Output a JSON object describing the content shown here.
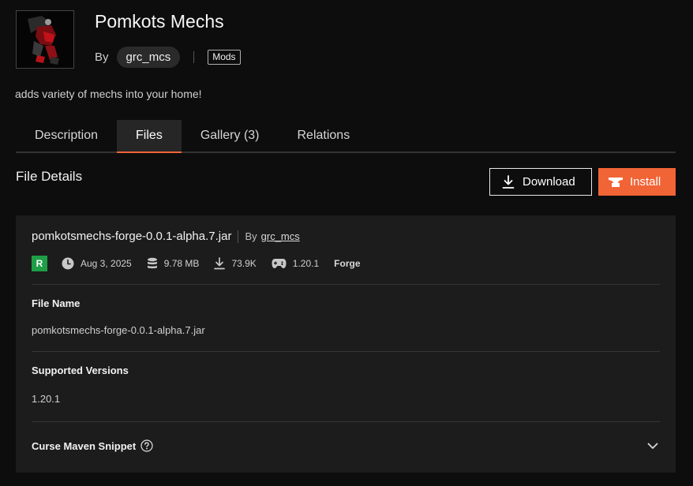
{
  "project": {
    "title": "Pomkots Mechs",
    "by_label": "By",
    "author": "grc_mcs",
    "category": "Mods",
    "summary": "adds variety of mechs into your home!"
  },
  "tabs": [
    {
      "label": "Description",
      "active": false
    },
    {
      "label": "Files",
      "active": true
    },
    {
      "label": "Gallery (3)",
      "active": false
    },
    {
      "label": "Relations",
      "active": false
    }
  ],
  "file_details": {
    "heading": "File Details",
    "download_label": "Download",
    "install_label": "Install",
    "file_title": "pomkotsmechs-forge-0.0.1-alpha.7.jar",
    "by_label": "By",
    "author": "grc_mcs",
    "release_type": "R",
    "date": "Aug 3, 2025",
    "size": "9.78 MB",
    "downloads": "73.9K",
    "game_version": "1.20.1",
    "loader": "Forge",
    "file_name_label": "File Name",
    "file_name": "pomkotsmechs-forge-0.0.1-alpha.7.jar",
    "supported_versions_label": "Supported Versions",
    "supported_versions": "1.20.1",
    "maven_label": "Curse Maven Snippet"
  },
  "colors": {
    "accent": "#f16436",
    "release_green": "#1e9e46",
    "background": "#0d0d0d",
    "panel": "#1c1c1c"
  },
  "icons": {
    "clock": "clock-icon",
    "size": "database-icon",
    "downloads": "download-icon",
    "game_version": "gamepad-icon",
    "help": "question-circle-icon",
    "expand": "chevron-down-icon",
    "install": "anvil-icon"
  }
}
